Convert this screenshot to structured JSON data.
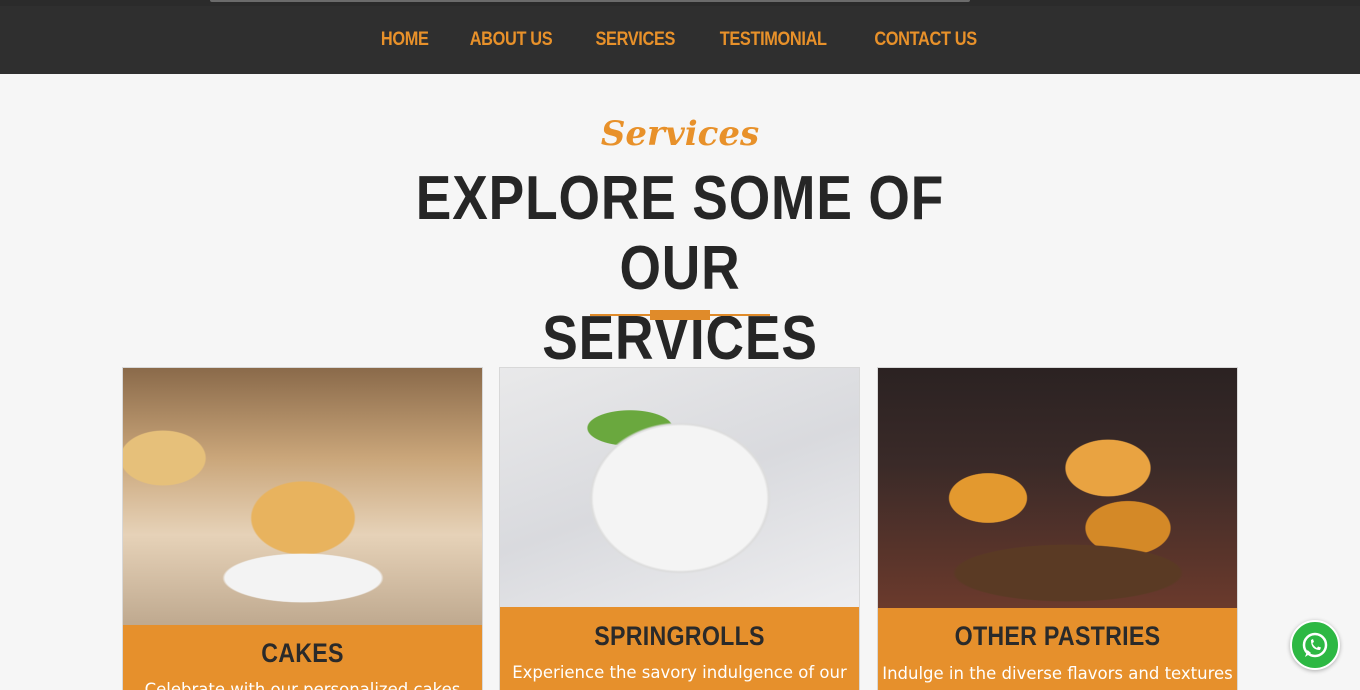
{
  "nav": {
    "items": [
      {
        "label": "HOME"
      },
      {
        "label": "ABOUT US"
      },
      {
        "label": "SERVICES"
      },
      {
        "label": "TESTIMONIAL"
      },
      {
        "label": "CONTACT US"
      }
    ]
  },
  "section": {
    "script_title": "Services",
    "title_line1": "EXPLORE SOME OF OUR",
    "title_line2": "SERVICES"
  },
  "cards": [
    {
      "title": "CAKES",
      "text": "Celebrate with our personalized cakes",
      "image": "cake-photo"
    },
    {
      "title": "SPRINGROLLS",
      "text": "Experience the savory indulgence of our",
      "image": "springrolls-photo"
    },
    {
      "title": "OTHER PASTRIES",
      "text": "Indulge in the diverse flavors and textures",
      "image": "pastries-photo"
    }
  ],
  "colors": {
    "accent": "#e8912a",
    "nav_bg": "#2f2f2f",
    "title": "#262626",
    "whatsapp": "#2db843"
  },
  "icons": {
    "whatsapp": "whatsapp-icon"
  }
}
